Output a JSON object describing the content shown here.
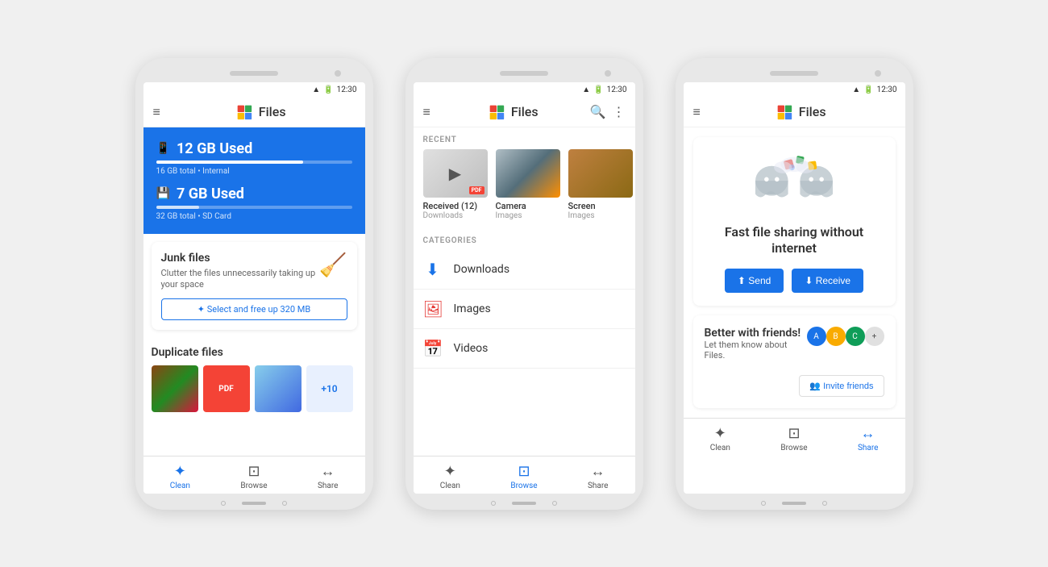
{
  "background_color": "#f0f0f0",
  "phones": [
    {
      "id": "phone1",
      "screen": "clean",
      "status_bar": {
        "time": "12:30"
      },
      "header": {
        "title": "Files",
        "menu_icon": "≡"
      },
      "storage": [
        {
          "type": "internal",
          "icon": "📱",
          "used": "12 GB Used",
          "total": "16 GB total • Internal",
          "percent": 75
        },
        {
          "type": "sd",
          "icon": "💾",
          "used": "7 GB Used",
          "total": "32 GB total • SD Card",
          "percent": 22
        }
      ],
      "junk_card": {
        "title": "Junk files",
        "description": "Clutter the files unnecessarily taking up your space",
        "button_label": "✦ Select and free up 320 MB"
      },
      "duplicate_section": {
        "title": "Duplicate files"
      },
      "nav": {
        "items": [
          {
            "label": "Clean",
            "icon": "✦",
            "active": true
          },
          {
            "label": "Browse",
            "icon": "⊡",
            "active": false
          },
          {
            "label": "Share",
            "icon": "↔",
            "active": false
          }
        ]
      }
    },
    {
      "id": "phone2",
      "screen": "browse",
      "status_bar": {
        "time": "12:30"
      },
      "header": {
        "title": "Files",
        "menu_icon": "≡",
        "search_icon": "🔍",
        "more_icon": "⋮"
      },
      "recent_section": {
        "label": "RECENT",
        "items": [
          {
            "name": "Received (12)",
            "type": "Downloads",
            "thumb": "received"
          },
          {
            "name": "Camera",
            "type": "Images",
            "thumb": "camera"
          },
          {
            "name": "Screen",
            "type": "Images",
            "thumb": "screen"
          }
        ]
      },
      "categories_section": {
        "label": "CATEGORIES",
        "items": [
          {
            "name": "Downloads",
            "icon": "⬇"
          },
          {
            "name": "Images",
            "icon": "🖼"
          },
          {
            "name": "Videos",
            "icon": "📅"
          }
        ]
      },
      "nav": {
        "items": [
          {
            "label": "Clean",
            "icon": "✦",
            "active": false
          },
          {
            "label": "Browse",
            "icon": "⊡",
            "active": true
          },
          {
            "label": "Share",
            "icon": "↔",
            "active": false
          }
        ]
      }
    },
    {
      "id": "phone3",
      "screen": "share",
      "status_bar": {
        "time": "12:30"
      },
      "header": {
        "title": "Files",
        "menu_icon": "≡"
      },
      "sharing_card": {
        "title": "Fast file sharing\nwithout internet",
        "send_label": "⬆ Send",
        "receive_label": "⬇ Receive"
      },
      "friends_card": {
        "title": "Better with friends!",
        "subtitle": "Let them know about Files.",
        "invite_label": "👥 Invite friends"
      },
      "nav": {
        "items": [
          {
            "label": "Clean",
            "icon": "✦",
            "active": false
          },
          {
            "label": "Browse",
            "icon": "⊡",
            "active": false
          },
          {
            "label": "Share",
            "icon": "↔",
            "active": true
          }
        ]
      }
    }
  ]
}
